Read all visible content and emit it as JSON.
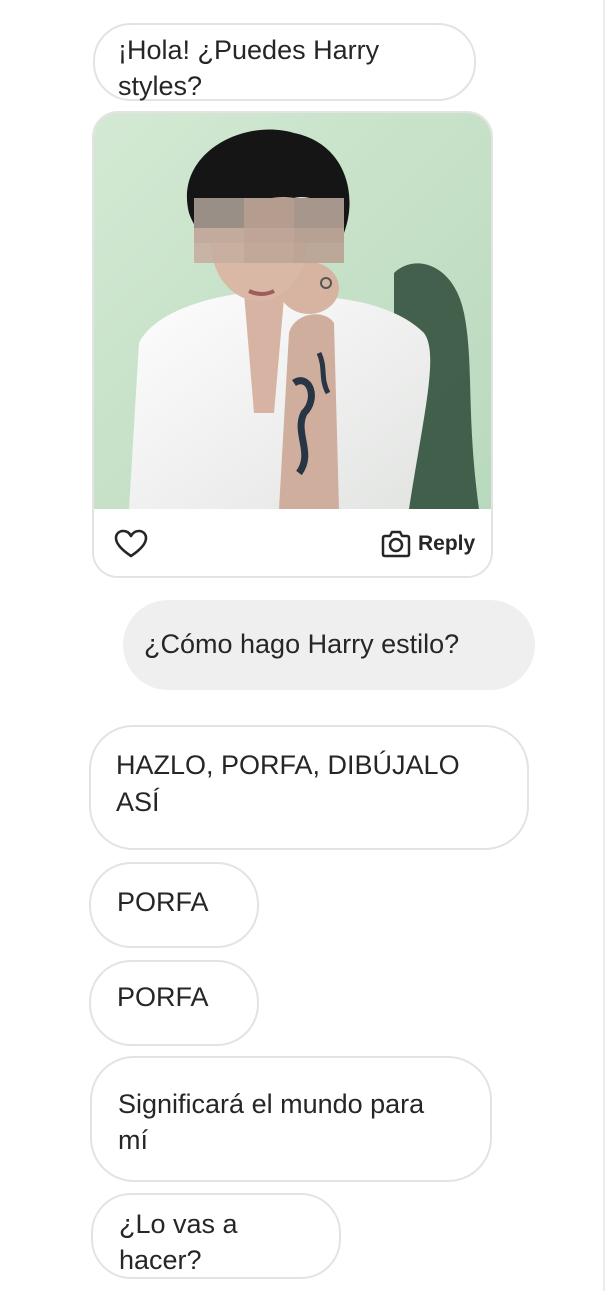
{
  "messages": [
    {
      "text": "¡Hola! ¿Puedes Harry styles?",
      "lines": [
        "¡Hola! ¿Puedes Harry",
        "styles?"
      ],
      "direction": "received"
    },
    {
      "text": "¿Cómo hago Harry estilo?",
      "direction": "sent"
    },
    {
      "text": "HAZLO, PORFA, DIBÚJALO ASÍ",
      "lines": [
        "HAZLO, PORFA, DIBÚJALO",
        "ASÍ"
      ],
      "direction": "received"
    },
    {
      "text": "PORFA",
      "direction": "received"
    },
    {
      "text": "PORFA",
      "direction": "received"
    },
    {
      "text": "Significará el mundo para mí",
      "lines": [
        "Significará el mundo para",
        "mí"
      ],
      "direction": "received"
    },
    {
      "text": "¿Lo vas a hacer?",
      "lines": [
        "¿Lo vas a",
        "hacer?"
      ],
      "direction": "received"
    }
  ],
  "shared_post": {
    "image": "photo of a dark-haired man in a white shirt, chin on hand, face pixelated, against a pale green wall",
    "like_icon": "heart-icon",
    "reply_icon": "camera-icon",
    "reply_label": "Reply"
  },
  "colors": {
    "bubble_border": "#e3e3e3",
    "sent_bubble_bg": "#efefef",
    "text": "#262626",
    "photo_background": "#cfe6cf"
  }
}
